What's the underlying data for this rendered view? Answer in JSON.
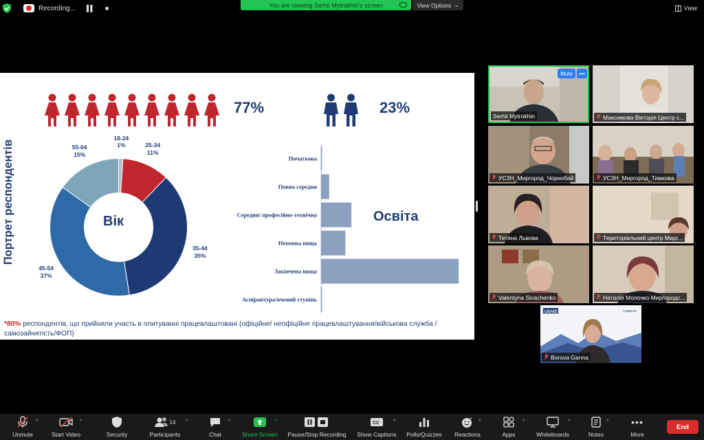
{
  "top_bar": {
    "recording_label": "Recording...",
    "viewing_banner": "You are viewing Serhii Mytrokhin's screen",
    "view_options_label": "View Options",
    "view_label": "View"
  },
  "slide": {
    "vertical_title": "Портрет респондентів",
    "women_pct": "77%",
    "men_pct": "23%",
    "age_center_label": "Вік",
    "education_title": "Освіта",
    "footnote_star": "*80%",
    "footnote_text": " респондентів, що прийняли участь в опитуванні працевлаштовані (офіційне/ неофіційне працевлаштування/військова служба /самозайнятість/ФОП)"
  },
  "chart_data": [
    {
      "type": "pie",
      "title": "Вік",
      "categories": [
        "18-24",
        "25-34",
        "35-44",
        "45-54",
        "55-64"
      ],
      "values": [
        1,
        11,
        35,
        37,
        15
      ],
      "labels": [
        "1%",
        "11%",
        "35%",
        "37%",
        "15%"
      ],
      "colors": [
        "#b9bec6",
        "#c0262d",
        "#1d3a75",
        "#2f6aa8",
        "#7ea6b8"
      ]
    },
    {
      "type": "bar",
      "orientation": "horizontal",
      "categories": [
        "Початкова",
        "Повна середня",
        "Середня/ професійно-технічна",
        "Неповна вища",
        "Закінчена вища",
        "Аспірантура/вчений ступінь"
      ],
      "values": [
        0.5,
        4,
        15,
        12,
        68,
        0.5
      ],
      "xlim": [
        0,
        70
      ],
      "xticks": [
        "0%",
        "10%",
        "20%",
        "30%",
        "40%",
        "50%",
        "60%",
        "70%"
      ],
      "bar_color": "#8c9fbf",
      "grid": false
    }
  ],
  "participants": [
    {
      "name": "Serhii Mytrokhin",
      "active": true,
      "muted": false
    },
    {
      "name": "Максимова Вікторія Центр с...",
      "muted": true
    },
    {
      "name": "УСЗН_Миргород_Чорнобай",
      "muted": true
    },
    {
      "name": "УСЗН_Миргород_Тимкова",
      "muted": true
    },
    {
      "name": "Тетяна Львова",
      "muted": true
    },
    {
      "name": "Територіальний центр Мирг...",
      "muted": true
    },
    {
      "name": "Valentyna Sivachenko",
      "muted": true
    },
    {
      "name": "Наталія Молочко Миргородс...",
      "muted": true
    },
    {
      "name": "Borova Ganna",
      "muted": true
    }
  ],
  "tile_controls": {
    "mute": "Mute",
    "more": "•••"
  },
  "toolbar": {
    "unmute": "Unmute",
    "start_video": "Start Video",
    "security": "Security",
    "participants": "Participants",
    "participants_count": "14",
    "chat": "Chat",
    "share_screen": "Share Screen",
    "pause_recording": "Pause/Stop Recording",
    "captions": "Show Captions",
    "polls": "Polls/Quizzes",
    "reactions": "Reactions",
    "apps": "Apps",
    "whiteboards": "Whiteboards",
    "notes": "Notes",
    "more": "More",
    "end": "End"
  }
}
